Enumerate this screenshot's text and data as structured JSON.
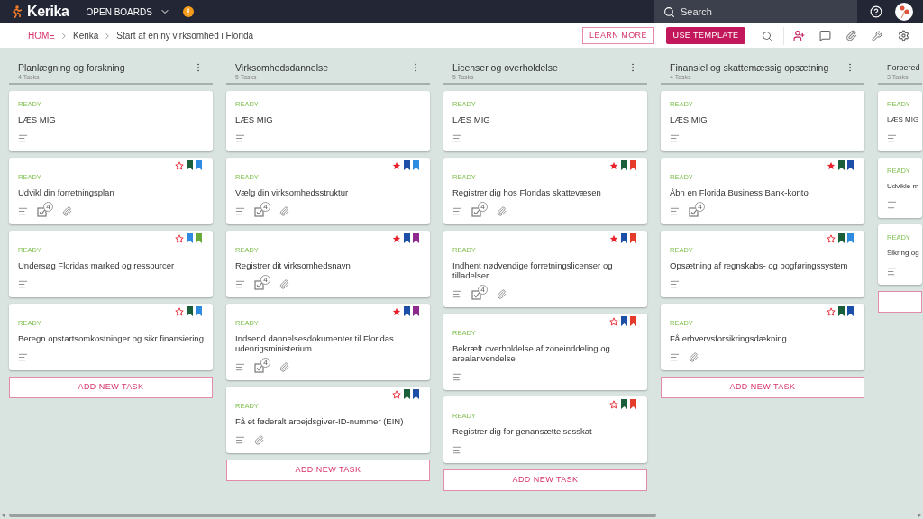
{
  "top_bar": {
    "logo": "Kerika",
    "boards_menu": "OPEN BOARDS",
    "search": {
      "placeholder": "Search"
    }
  },
  "breadcrumb": [
    "HOME",
    "Kerika",
    "Start af en ny virksomhed i Florida"
  ],
  "actions": {
    "learn_more": "LEARN MORE",
    "use_template": "USE TEMPLATE"
  },
  "columns": [
    {
      "title": "Planlægning og forskning",
      "count": "4 Tasks",
      "menu": true,
      "add_task": "ADD NEW TASK",
      "cards": [
        {
          "status": "READY",
          "title": "LÆS MIG",
          "attachment": false
        },
        {
          "status": "READY",
          "title": "Udvikl din forretningsplan",
          "checklist": "4",
          "attachment": true,
          "starred": false,
          "flags": [
            {
              "color": "#1b5e3a"
            },
            {
              "color": "#2e8be0"
            }
          ]
        },
        {
          "status": "READY",
          "title": "Undersøg Floridas marked og ressourcer",
          "attachment": false,
          "starred": false,
          "flags": [
            {
              "color": "#2e8be0"
            },
            {
              "color": "#6aaa3a"
            }
          ]
        },
        {
          "status": "READY",
          "title": "Beregn opstartsomkostninger og sikr finansiering",
          "attachment": false,
          "starred": false,
          "flags": [
            {
              "color": "#1b5e3a"
            },
            {
              "color": "#2e8be0"
            }
          ]
        }
      ]
    },
    {
      "title": "Virksomhedsdannelse",
      "count": "5 Tasks",
      "menu": true,
      "add_task": "ADD NEW TASK",
      "cards": [
        {
          "status": "READY",
          "title": "LÆS MIG",
          "attachment": false
        },
        {
          "status": "READY",
          "title": "Vælg din virksomhedsstruktur",
          "checklist": "4",
          "attachment": true,
          "starred": true,
          "flags": [
            {
              "color": "#1e4fa8"
            },
            {
              "color": "#2e8be0"
            }
          ]
        },
        {
          "status": "READY",
          "title": "Registrer dit virksomhedsnavn",
          "checklist": "4",
          "attachment": true,
          "starred": true,
          "flags": [
            {
              "color": "#1e4fa8"
            },
            {
              "color": "#8e2a8e"
            }
          ]
        },
        {
          "status": "READY",
          "title": "Indsend dannelsesdokumenter til Floridas udenrigsministerium",
          "checklist": "4",
          "attachment": true,
          "starred": true,
          "flags": [
            {
              "color": "#1e4fa8"
            },
            {
              "color": "#8e2a8e"
            }
          ]
        },
        {
          "status": "READY",
          "title": "Få et føderalt arbejdsgiver-ID-nummer (EIN)",
          "attachment": true,
          "starred": false,
          "flags": [
            {
              "color": "#1b5e3a"
            },
            {
              "color": "#1e4fa8"
            }
          ]
        }
      ]
    },
    {
      "title": "Licenser og overholdelse",
      "count": "5 Tasks",
      "menu": true,
      "add_task": "ADD NEW TASK",
      "cards": [
        {
          "status": "READY",
          "title": "LÆS MIG",
          "attachment": false
        },
        {
          "status": "READY",
          "title": "Registrer dig hos Floridas skattevæsen",
          "checklist": "4",
          "attachment": true,
          "starred": true,
          "flags": [
            {
              "color": "#1b5e3a"
            },
            {
              "color": "#e53b2c"
            }
          ]
        },
        {
          "status": "READY",
          "title": "Indhent nødvendige forretningslicenser og tilladelser",
          "checklist": "4",
          "attachment": true,
          "starred": true,
          "flags": [
            {
              "color": "#1e4fa8"
            },
            {
              "color": "#e53b2c"
            }
          ]
        },
        {
          "status": "READY",
          "title": "Bekræft overholdelse af zoneinddeling og arealanvendelse",
          "attachment": false,
          "starred": false,
          "flags": [
            {
              "color": "#1e4fa8"
            },
            {
              "color": "#e53b2c"
            }
          ]
        },
        {
          "status": "READY",
          "title": "Registrer dig for genansættelsesskat",
          "attachment": false,
          "starred": false,
          "flags": [
            {
              "color": "#1b5e3a"
            },
            {
              "color": "#e53b2c"
            }
          ]
        }
      ]
    },
    {
      "title": "Finansiel og skattemæssig opsætning",
      "count": "4 Tasks",
      "menu": true,
      "add_task": "ADD NEW TASK",
      "cards": [
        {
          "status": "READY",
          "title": "LÆS MIG",
          "attachment": false
        },
        {
          "status": "READY",
          "title": "Åbn en Florida Business Bank-konto",
          "checklist": "4",
          "attachment": false,
          "starred": true,
          "flags": [
            {
              "color": "#1b5e3a"
            },
            {
              "color": "#1e4fa8"
            }
          ]
        },
        {
          "status": "READY",
          "title": "Opsætning af regnskabs- og bogføringssystem",
          "attachment": false,
          "starred": false,
          "flags": [
            {
              "color": "#1b5e3a"
            },
            {
              "color": "#2e8be0"
            }
          ]
        },
        {
          "status": "READY",
          "title": "Få erhvervsforsikringsdækning",
          "attachment": true,
          "starred": false,
          "flags": [
            {
              "color": "#1b5e3a"
            },
            {
              "color": "#1e4fa8"
            }
          ]
        }
      ]
    },
    {
      "title": "Forbered",
      "count": "3 Tasks",
      "menu": false,
      "cards": [
        {
          "status": "READY",
          "title": "LÆS MIG",
          "attachment": false
        },
        {
          "status": "READY",
          "title": "Udvikle m",
          "attachment": false
        },
        {
          "status": "READY",
          "title": "Sikring og",
          "attachment": false
        }
      ]
    }
  ]
}
